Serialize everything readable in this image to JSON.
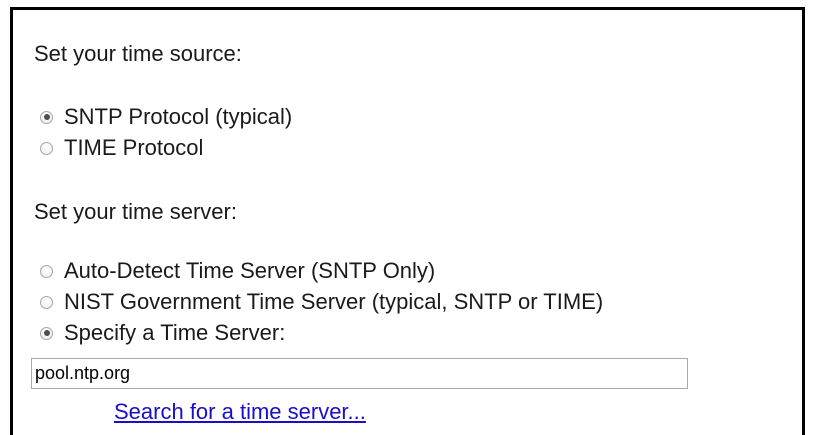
{
  "time_source": {
    "heading": "Set your time source:",
    "options": [
      {
        "label": "SNTP Protocol (typical)",
        "checked": true
      },
      {
        "label": "TIME Protocol",
        "checked": false
      }
    ]
  },
  "time_server": {
    "heading": "Set your time server:",
    "options": [
      {
        "label": "Auto-Detect Time Server (SNTP Only)",
        "checked": false
      },
      {
        "label": "NIST Government Time Server (typical, SNTP or TIME)",
        "checked": false
      },
      {
        "label": "Specify a Time Server:",
        "checked": true
      }
    ],
    "input_value": "pool.ntp.org",
    "search_link": "Search for a time server..."
  },
  "colors": {
    "border": "#000000",
    "link": "#1a0dcc",
    "text": "#1a1a1a",
    "radio_border": "#a6a6a6",
    "radio_dot": "#4d4d4d"
  },
  "icons": {
    "radio_checked": "radio-checked-icon",
    "radio_unchecked": "radio-unchecked-icon"
  }
}
